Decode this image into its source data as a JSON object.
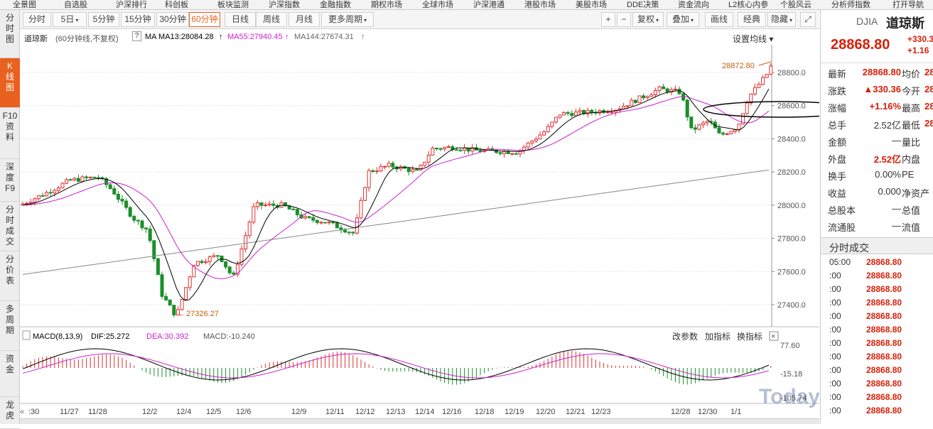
{
  "menu": [
    "全景图",
    "自选股",
    "沪深排行",
    "科创板",
    "板块监测",
    "沪深指数",
    "金融指数",
    "期权市场",
    "全球市场",
    "沪深港通",
    "港股市场",
    "美股市场",
    "DDE决策",
    "资金流向",
    "L2核心内参",
    "个股风云",
    "分析师指数",
    "打开导航"
  ],
  "sidetabs": [
    {
      "label": "分时图"
    },
    {
      "label": "K线图"
    },
    {
      "label": "F10资料"
    },
    {
      "label": "深度F9"
    },
    {
      "label": "分时成交"
    },
    {
      "label": "分价表"
    },
    {
      "label": "多周期"
    },
    {
      "label": "资金"
    },
    {
      "label": "龙虎"
    }
  ],
  "periods": [
    "分时",
    "5日",
    "5分钟",
    "15分钟",
    "30分钟",
    "60分钟",
    "日线",
    "周线",
    "月线",
    "更多周期"
  ],
  "tools": {
    "plus": "+",
    "minus": "−",
    "adjust": "复权",
    "overlay": "叠加",
    "draw": "画线",
    "classic": "经典",
    "hide": "隐藏"
  },
  "info": {
    "name": "道琼斯",
    "desc": "(60分钟线,不复权)",
    "help": "?",
    "ma": "MA",
    "ma13": "MA13:28084.28",
    "ma55": "MA55:27940.45",
    "ma144": "MA144:27674.31",
    "settings": "设置均线"
  },
  "macd": {
    "label": "MACD(8,13,9)",
    "dif": "DIF:25.272",
    "dea": "DEA:30.392",
    "macd": "MACD:-10.240",
    "change": "改参数",
    "add": "加指标",
    "switch": "换指标",
    "close": "×",
    "axis": [
      "77.60",
      "-15.18",
      "-105.74"
    ]
  },
  "chart_data": {
    "type": "candlestick",
    "y_ticks": [
      28800,
      28600,
      28400,
      28200,
      28000,
      27800,
      27600,
      27400
    ],
    "high_label": "28872.80",
    "low_label": "27326.27",
    "x_labels": [
      ":30",
      "11/27",
      "11/28",
      "12/2",
      "12/4",
      "12/5",
      "12/6",
      "12/9",
      "12/11",
      "12/12",
      "12/13",
      "12/14",
      "12/16",
      "12/18",
      "12/19",
      "12/20",
      "12/21",
      "12/23",
      "12/28",
      "12/30",
      "1/1"
    ],
    "series": [
      {
        "name": "MA13"
      },
      {
        "name": "MA55"
      },
      {
        "name": "MA144"
      }
    ],
    "colors": {
      "up": "#e03030",
      "down": "#1a8f2a",
      "ma13": "#000000",
      "ma55": "#cc22cc",
      "ma144": "#888888"
    }
  },
  "quote": {
    "code": "DJIA",
    "name": "道琼斯",
    "price": "28868.80",
    "chg": "+330.3",
    "pct": "+1.16",
    "rows": [
      {
        "l1": "最新",
        "v1": "28868.80",
        "l2": "均价",
        "v2": "28"
      },
      {
        "l1": "涨跌",
        "v1": "▲330.36",
        "l2": "今开",
        "v2": "28"
      },
      {
        "l1": "涨幅",
        "v1": "+1.16%",
        "l2": "最高",
        "v2": "28"
      },
      {
        "l1": "总手",
        "v1": "2.52亿",
        "l2": "最低",
        "v2": "28"
      },
      {
        "l1": "金额",
        "v1": "—",
        "l2": "量比",
        "v2": ""
      },
      {
        "l1": "外盘",
        "v1": "2.52亿",
        "l2": "内盘",
        "v2": ""
      },
      {
        "l1": "换手",
        "v1": "0.00%",
        "l2": "PE",
        "v2": ""
      },
      {
        "l1": "收益",
        "v1": "0.000",
        "l2": "净资产",
        "v2": ""
      },
      {
        "l1": "总股本",
        "v1": "—",
        "l2": "总值",
        "v2": ""
      },
      {
        "l1": "流通股",
        "v1": "—",
        "l2": "流值",
        "v2": ""
      }
    ]
  },
  "trades": {
    "title": "分时成交",
    "rows": [
      {
        "t": "05:00",
        "p": "28868.80"
      },
      {
        "t": ":00",
        "p": "28868.80"
      },
      {
        "t": ":00",
        "p": "28868.80"
      },
      {
        "t": ":00",
        "p": "28868.80"
      },
      {
        "t": ":00",
        "p": "28868.80"
      },
      {
        "t": ":00",
        "p": "28868.80"
      },
      {
        "t": ":00",
        "p": "28868.80"
      },
      {
        "t": ":00",
        "p": "28868.80"
      },
      {
        "t": ":00",
        "p": "28868.80"
      },
      {
        "t": ":00",
        "p": "28868.80"
      },
      {
        "t": ":00",
        "p": "28868.80"
      },
      {
        "t": ":00",
        "p": "28868.80"
      }
    ]
  },
  "watermark": "TodayUSStock"
}
